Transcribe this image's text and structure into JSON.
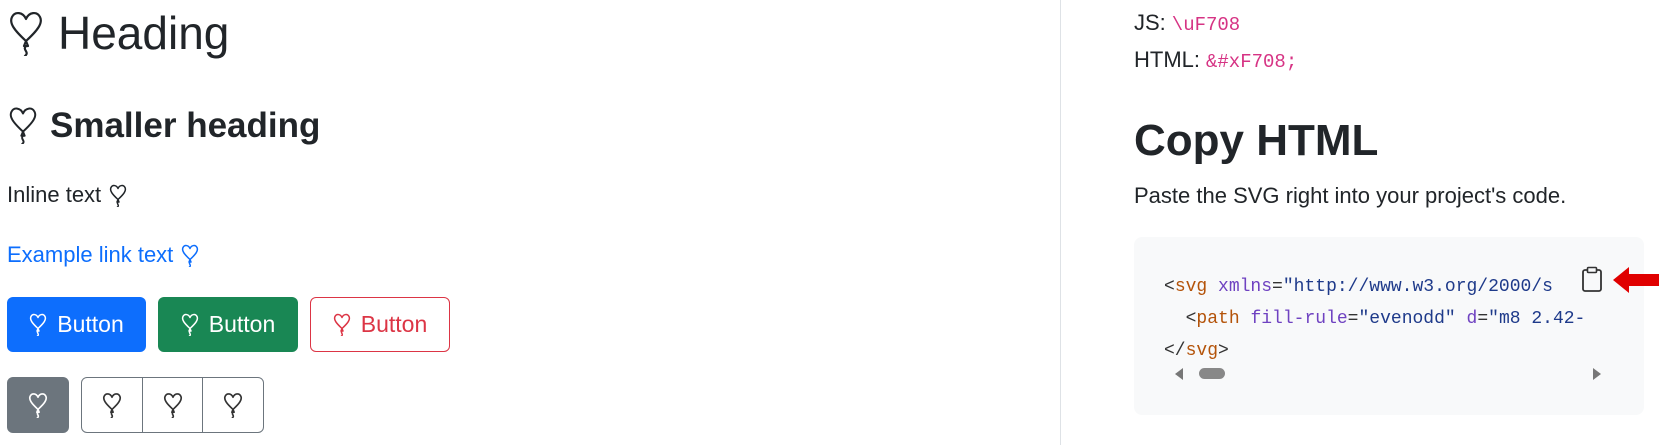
{
  "left": {
    "heading": "Heading",
    "subheading": "Smaller heading",
    "inline_text": "Inline text",
    "link_text": "Example link text",
    "buttons": {
      "primary_label": "Button",
      "success_label": "Button",
      "outline_danger_label": "Button"
    }
  },
  "right": {
    "js_label": "JS:",
    "js_code": "\\uF708",
    "html_label": "HTML:",
    "html_code": "&#xF708;",
    "copy_title": "Copy HTML",
    "copy_desc": "Paste the SVG right into your project's code.",
    "code": {
      "line1_tag": "svg",
      "line1_attr": "xmlns",
      "line1_val": "\"http://www.w3.org/2000/s",
      "line2_tag": "path",
      "line2_attr1": "fill-rule",
      "line2_val1": "\"evenodd\"",
      "line2_attr2": "d",
      "line2_val2": "\"m8 2.42-",
      "line3_close": "svg"
    }
  },
  "colors": {
    "primary": "#0d6efd",
    "success": "#198754",
    "danger": "#dc3545",
    "secondary": "#6c757d",
    "pink_code": "#d63384",
    "arrow_red": "#e00000"
  },
  "icons": {
    "balloon": "balloon-heart-icon",
    "clipboard": "clipboard-icon"
  }
}
